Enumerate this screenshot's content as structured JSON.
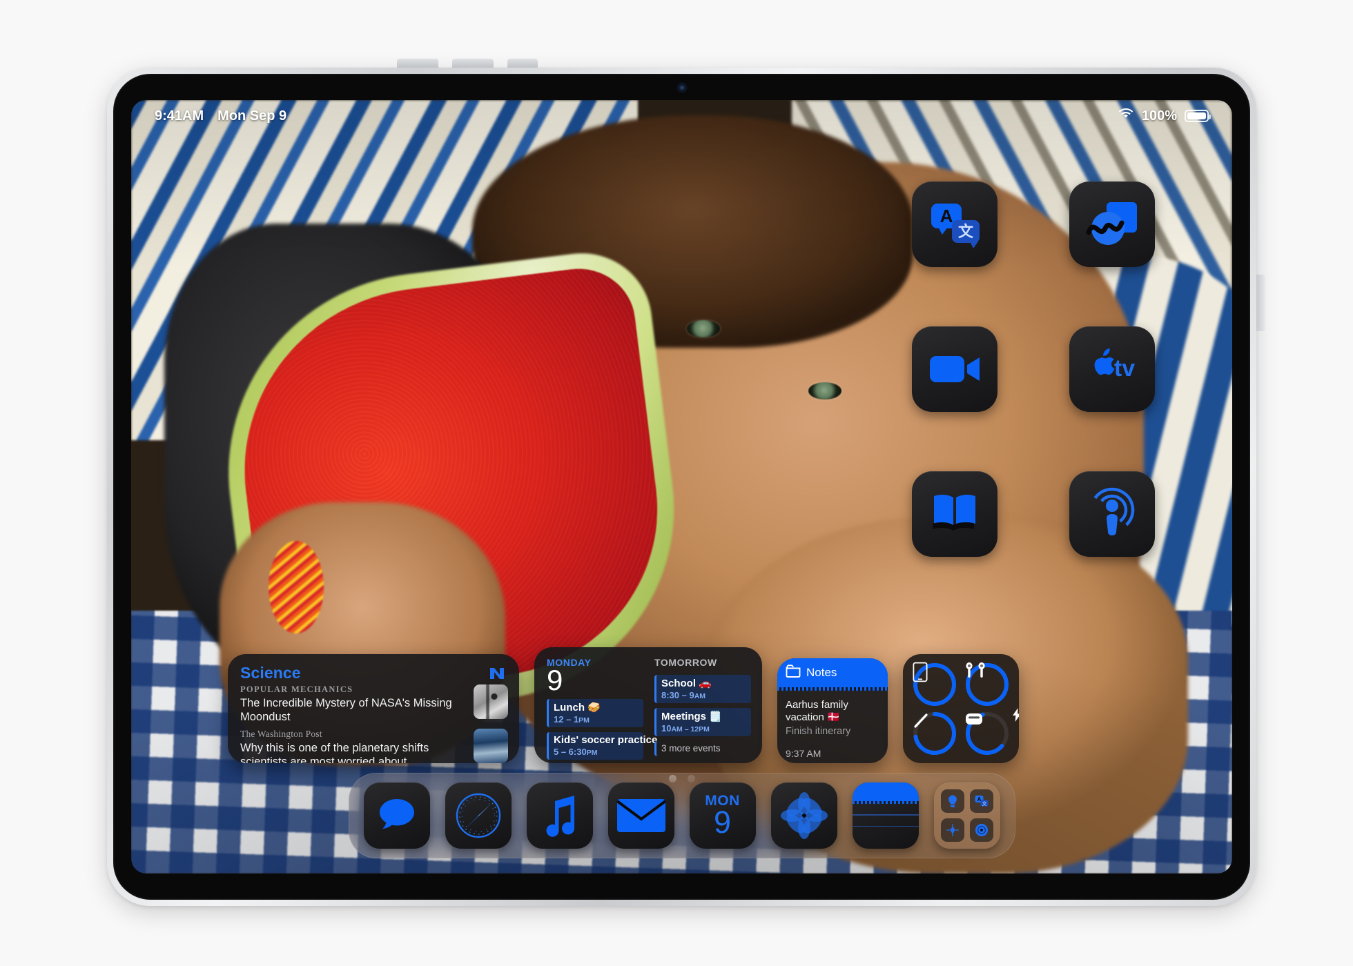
{
  "status_bar": {
    "time": "9:41AM",
    "date": "Mon Sep 9",
    "battery_percent": "100%",
    "wifi_icon": "wifi-icon",
    "battery_icon": "battery-full-icon"
  },
  "home_screen": {
    "apps": [
      {
        "name": "Translate",
        "icon": "translate-icon"
      },
      {
        "name": "Freeform",
        "icon": "freeform-icon"
      },
      {
        "name": "FaceTime",
        "icon": "facetime-icon"
      },
      {
        "name": "Apple TV",
        "icon": "apple-tv-icon"
      },
      {
        "name": "Books",
        "icon": "books-icon"
      },
      {
        "name": "Podcasts",
        "icon": "podcasts-icon"
      }
    ],
    "page_dots": {
      "count": 2,
      "active_index": 0
    }
  },
  "widgets": {
    "news": {
      "title": "Science",
      "app_logo": "apple-news-icon",
      "stories": [
        {
          "source": "POPULAR MECHANICS",
          "headline": "The Incredible Mystery of NASA's Missing Moondust",
          "thumbnail": "moon-photo-thumbnail"
        },
        {
          "source": "The Washington Post",
          "headline": "Why this is one of the planetary shifts scientists are most worried about",
          "thumbnail": "ice-photo-thumbnail"
        }
      ]
    },
    "calendar": {
      "today_label": "MONDAY",
      "today_number": "9",
      "tomorrow_label": "TOMORROW",
      "today_events": [
        {
          "title": "Lunch 🥪",
          "time_main": "12 – 1",
          "time_ampm": "PM"
        },
        {
          "title": "Kids' soccer practice",
          "time_main": "5 – 6:30",
          "time_ampm": "PM"
        }
      ],
      "tomorrow_events": [
        {
          "title": "School 🚗",
          "time_main": "8:30 – 9",
          "time_ampm": "AM"
        },
        {
          "title": "Meetings 🗒️",
          "time_main": "10",
          "time_ampm": "AM – 12PM"
        }
      ],
      "more_events": "3 more events"
    },
    "notes": {
      "header_title": "Notes",
      "header_icon": "folder-icon",
      "header_color": "#0a63f6",
      "note_title": "Aarhus family vacation 🇩🇰",
      "note_subtitle": "Finish itinerary",
      "timestamp": "9:37 AM"
    },
    "batteries": {
      "items": [
        {
          "name": "iPad",
          "icon": "ipad-icon",
          "level": 100,
          "charging": false
        },
        {
          "name": "AirPods",
          "icon": "airpods-icon",
          "level": 100,
          "charging": false
        },
        {
          "name": "Apple Pencil",
          "icon": "apple-pencil-icon",
          "level": 72,
          "charging": false
        },
        {
          "name": "AirPods Case",
          "icon": "airpods-case-icon",
          "level": 60,
          "charging": true
        }
      ],
      "accent_color": "#0a63f6"
    }
  },
  "dock": {
    "apps": [
      {
        "name": "Messages",
        "icon": "messages-icon"
      },
      {
        "name": "Safari",
        "icon": "safari-icon"
      },
      {
        "name": "Music",
        "icon": "music-icon"
      },
      {
        "name": "Mail",
        "icon": "mail-icon"
      },
      {
        "name": "Calendar",
        "icon": "calendar-icon",
        "month": "MON",
        "day": "9"
      },
      {
        "name": "Photos",
        "icon": "photos-icon"
      },
      {
        "name": "Notes",
        "icon": "notes-icon"
      },
      {
        "name": "Utilities Folder",
        "icon": "app-folder-icon",
        "contents": [
          "tips-icon",
          "translate-icon",
          "measure-icon",
          "camera-icon"
        ]
      }
    ]
  },
  "wallpaper": {
    "description": "Boy eating a watermelon slice on striped pillows and gingham blanket"
  },
  "theme": {
    "accent_blue": "#0a63f6",
    "icon_dark": "#1c1c1e",
    "text_primary": "#f2f2f4",
    "text_secondary": "#9d9da1"
  }
}
